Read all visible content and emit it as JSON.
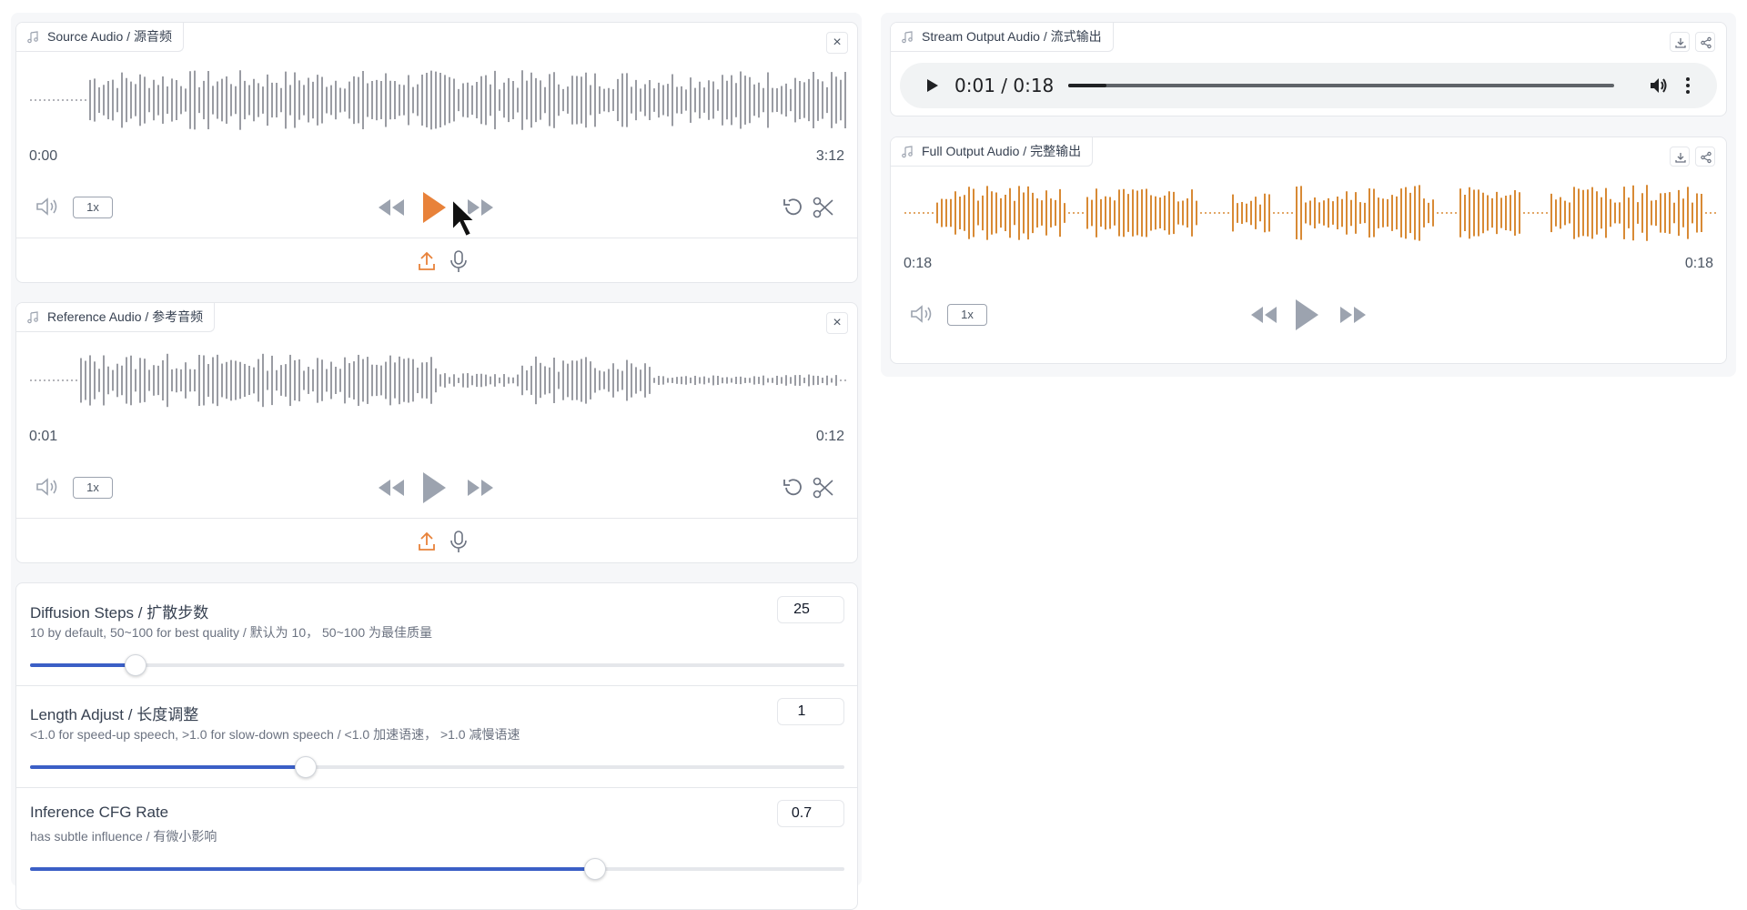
{
  "source_audio": {
    "label": "Source Audio / 源音频",
    "time_start": "0:00",
    "time_end": "3:12",
    "rate": "1x",
    "wave_color": "#9a9ca3",
    "play_color": "#e8823a"
  },
  "reference_audio": {
    "label": "Reference Audio / 参考音频",
    "time_start": "0:01",
    "time_end": "0:12",
    "rate": "1x",
    "wave_color": "#9a9ca3"
  },
  "stream_output": {
    "label": "Stream Output Audio / 流式输出",
    "time_display": "0:01 / 0:18",
    "progress": 0.07
  },
  "full_output": {
    "label": "Full Output Audio / 完整输出",
    "time_start": "0:18",
    "time_end": "0:18",
    "rate": "1x",
    "wave_color": "#d88a35"
  },
  "sliders": [
    {
      "label": "Diffusion Steps / 扩散步数",
      "info": "10 by default, 50~100 for best quality / 默认为 10， 50~100 为最佳质量",
      "value": "25",
      "fraction": 0.13
    },
    {
      "label": "Length Adjust / 长度调整",
      "info": "<1.0 for speed-up speech, >1.0 for slow-down speech / <1.0 加速语速， >1.0 减慢语速",
      "value": "1",
      "fraction": 0.338
    },
    {
      "label": "Inference CFG Rate",
      "info": "has subtle influence / 有微小影响",
      "value": "0.7",
      "fraction": 0.694
    }
  ],
  "colors": {
    "accent": "#e8823a",
    "slider": "#3b5fc6",
    "icon_gray": "#9ca3af"
  }
}
